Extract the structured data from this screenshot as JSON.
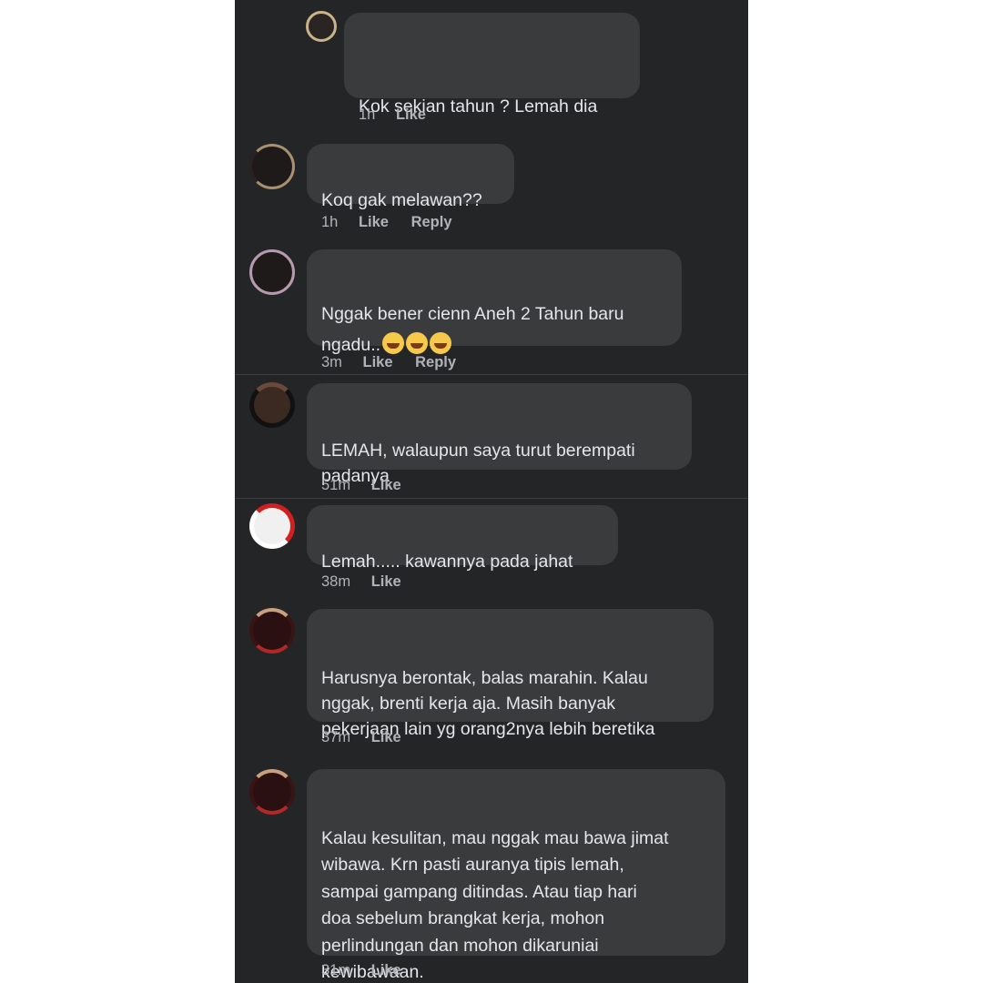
{
  "comments": [
    {
      "text": "Kok sekian tahun ? Lemah dia",
      "time": "1h",
      "like": "Like",
      "reply": null
    },
    {
      "text": "Koq gak melawan??",
      "time": "1h",
      "like": "Like",
      "reply": "Reply"
    },
    {
      "text": "Nggak bener cienn Aneh 2 Tahun baru\nngadu..",
      "emojis": [
        "face-with-tears-of-joy",
        "rolling-on-the-floor-laughing",
        "grinning-face-with-smiling-eyes"
      ],
      "time": "3m",
      "like": "Like",
      "reply": "Reply"
    },
    {
      "text": "LEMAH, walaupun saya turut berempati\npadanya",
      "time": "51m",
      "like": "Like",
      "reply": null
    },
    {
      "text": "Lemah..... kawannya pada jahat",
      "time": "38m",
      "like": "Like",
      "reply": null
    },
    {
      "text": "Harusnya berontak, balas marahin. Kalau\nnggak, brenti kerja aja. Masih banyak\npekerjaan lain yg orang2nya lebih beretika",
      "time": "37m",
      "like": "Like",
      "reply": null
    },
    {
      "text": "Kalau kesulitan, mau nggak mau bawa jimat\nwibawa. Krn pasti auranya tipis lemah,\nsampai gampang ditindas. Atau tiap hari\ndoa sebelum brangkat kerja, mohon\nperlindungan dan mohon dikaruniai\nkewibawaan.",
      "time": "31m",
      "like": "Like",
      "reply": null
    }
  ],
  "colors": {
    "background": "#242526",
    "bubble": "#3a3b3c",
    "text": "#e4e6eb",
    "meta": "#b0b3b8"
  }
}
